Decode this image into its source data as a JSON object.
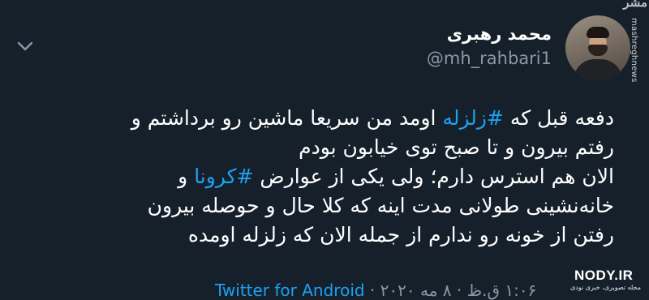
{
  "watermarks": {
    "top_right": "مشر",
    "side": "mashreghnews",
    "bottom_title": "NODY.IR",
    "bottom_sub": "مجله تصویری، خبری نودی"
  },
  "header": {
    "display_name": "محمد رهبری",
    "handle": "@mh_rahbari1",
    "menu_icon": "chevron-down-icon"
  },
  "tweet": {
    "lines": [
      {
        "before": "دفعه قبل که ",
        "hashtag": "#زلزله",
        "after": " اومد من سریعا ماشین رو برداشتم و"
      },
      {
        "text": "رفتم بیرون و تا صبح توی خیابون بودم"
      },
      {
        "before": "الان هم استرس دارم؛ ولی یکی از عوارض ",
        "hashtag": "#کرونا",
        "after": " و"
      },
      {
        "text": "خانه‌نشینی طولانی مدت اینه که کلا حال و حوصله بیرون"
      },
      {
        "text": "رفتن از خونه رو ندارم از جمله الان که زلزله اومده"
      }
    ]
  },
  "meta": {
    "time_date": "۱:۰۶ ق.ظ · ۸ مه ۲۰۲۰ · ",
    "source": "Twitter for Android"
  },
  "colors": {
    "background": "#15202b",
    "accent": "#1da1f2",
    "secondary_text": "#8899a6"
  }
}
